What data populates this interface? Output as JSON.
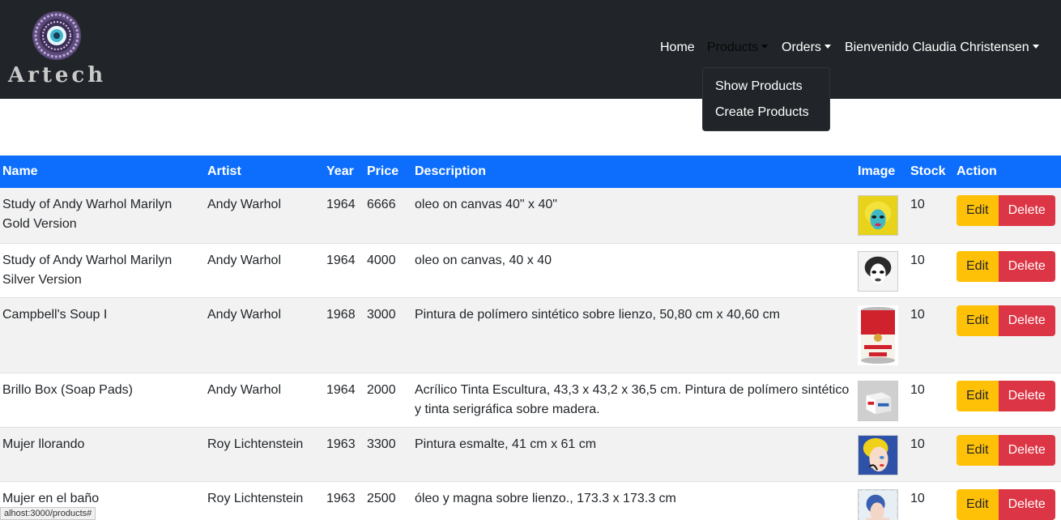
{
  "brand": {
    "name": "Artech"
  },
  "nav": {
    "home": "Home",
    "products": "Products",
    "orders": "Orders",
    "user": "Bienvenido Claudia Christensen"
  },
  "dropdown": {
    "items": [
      "Show Products",
      "Create Products"
    ]
  },
  "table": {
    "headers": [
      "Name",
      "Artist",
      "Year",
      "Price",
      "Description",
      "Image",
      "Stock",
      "Action"
    ],
    "rows": [
      {
        "name": "Study of Andy Warhol Marilyn Gold Version",
        "artist": "Andy Warhol",
        "year": "1964",
        "price": "6666",
        "description": "oleo on canvas 40\" x 40\"",
        "image": "marilyn-gold",
        "stock": "10"
      },
      {
        "name": "Study of Andy Warhol Marilyn Silver Version",
        "artist": "Andy Warhol",
        "year": "1964",
        "price": "4000",
        "description": "oleo on canvas, 40 x 40",
        "image": "marilyn-silver",
        "stock": "10"
      },
      {
        "name": "Campbell's Soup I",
        "artist": "Andy Warhol",
        "year": "1968",
        "price": "3000",
        "description": "Pintura de polímero sintético sobre lienzo, 50,80 cm x 40,60 cm",
        "image": "campbell-soup",
        "stock": "10"
      },
      {
        "name": "Brillo Box (Soap Pads)",
        "artist": "Andy Warhol",
        "year": "1964",
        "price": "2000",
        "description": "Acrílico Tinta Escultura, 43,3 x 43,2 x 36,5 cm. Pintura de polímero sintético y tinta serigráfica sobre madera.",
        "image": "brillo-box",
        "stock": "10"
      },
      {
        "name": "Mujer llorando",
        "artist": "Roy Lichtenstein",
        "year": "1963",
        "price": "3300",
        "description": "Pintura esmalte, 41 cm x 61 cm",
        "image": "crying-woman",
        "stock": "10"
      },
      {
        "name": "Mujer en el baño",
        "artist": "Roy Lichtenstein",
        "year": "1963",
        "price": "2500",
        "description": "óleo y magna sobre lienzo., 173.3 x 173.3 cm",
        "image": "woman-bath",
        "stock": "10"
      }
    ],
    "edit_label": "Edit",
    "delete_label": "Delete"
  },
  "status_bar": {
    "url": "alhost:3000/products#"
  },
  "colors": {
    "navbar_bg": "#212529",
    "header_bg": "#0d6efd",
    "edit_btn": "#ffc107",
    "delete_btn": "#dc3545"
  }
}
